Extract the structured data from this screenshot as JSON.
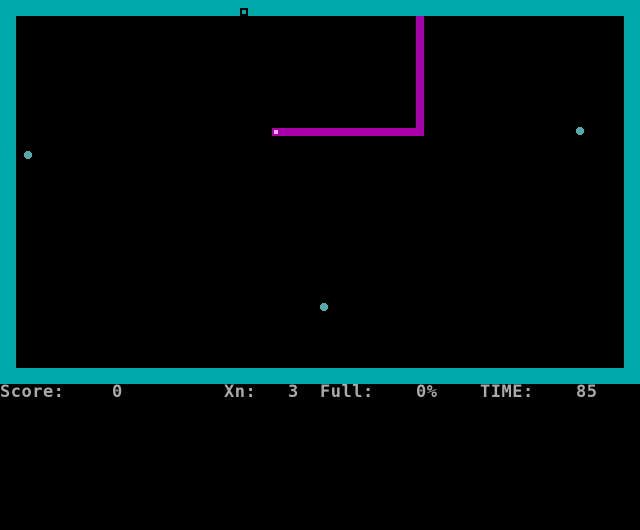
{
  "colors": {
    "border": "#00aaaa",
    "field": "#000000",
    "trail": "#aa00aa",
    "ball": "#55aaaa",
    "text": "#aaaaaa"
  },
  "status": {
    "score_label": "Score:",
    "score_value": "0",
    "xn_label": "Xn:",
    "xn_value": "3",
    "full_label": "Full:",
    "full_value": "0%",
    "time_label": "TIME:",
    "time_value": "85"
  },
  "icons": {
    "player": "player-cursor-icon",
    "ball": "bouncing-ball-icon",
    "border_eater": "border-eater-icon"
  }
}
